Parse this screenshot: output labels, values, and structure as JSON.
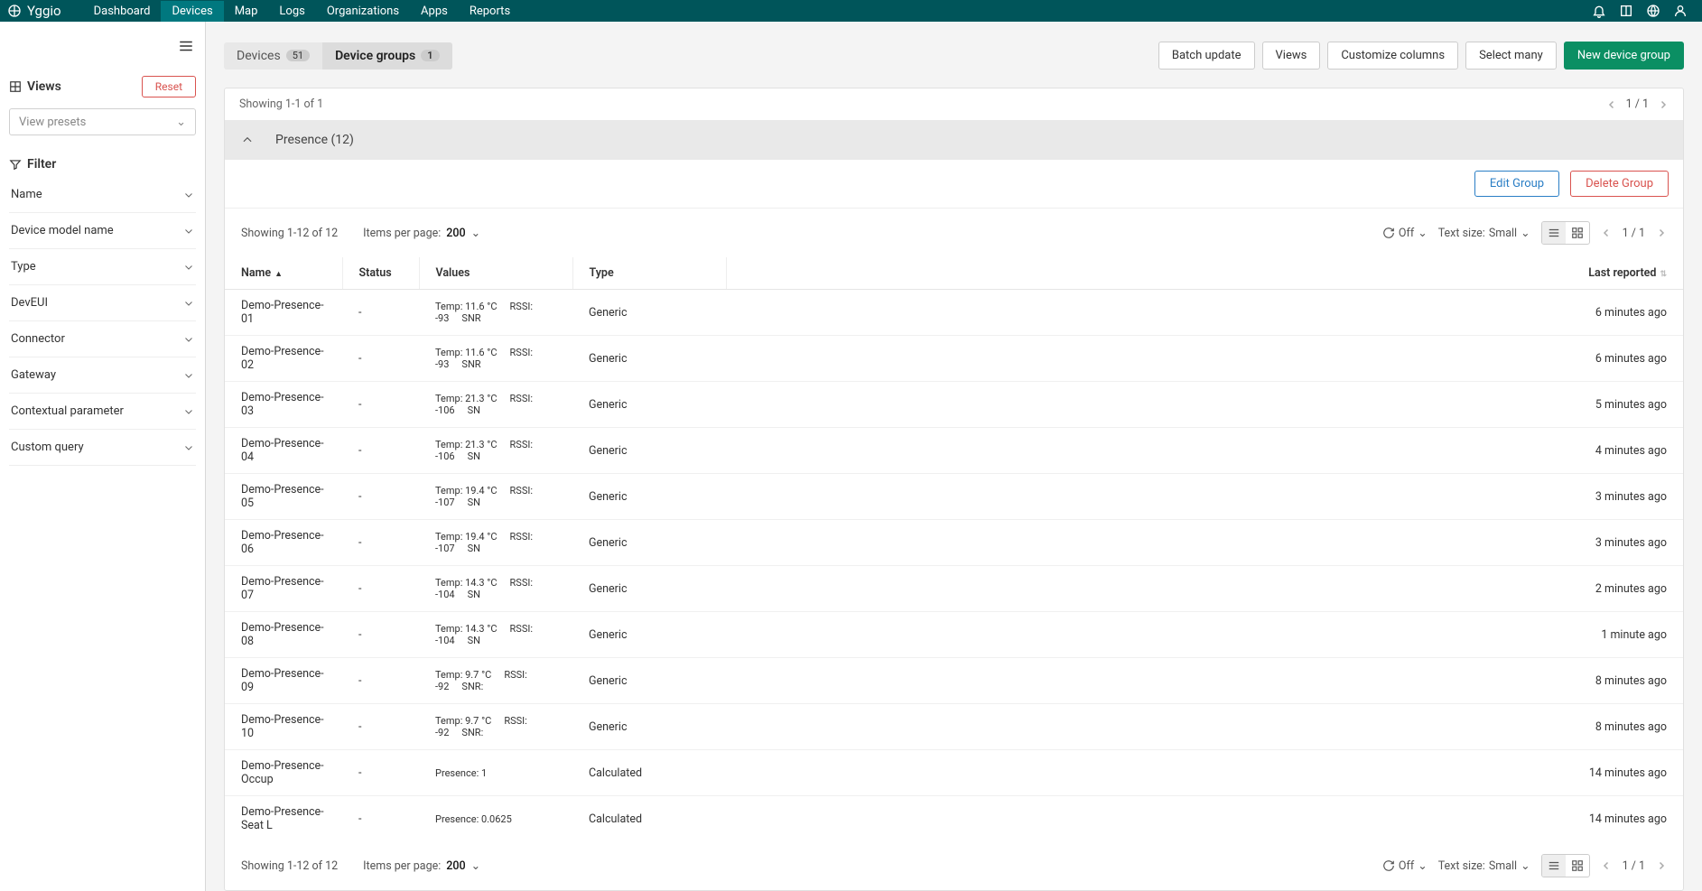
{
  "brand": "Yggio",
  "nav": [
    "Dashboard",
    "Devices",
    "Map",
    "Logs",
    "Organizations",
    "Apps",
    "Reports"
  ],
  "sidebar": {
    "views_label": "Views",
    "reset_label": "Reset",
    "preset_placeholder": "View presets",
    "filter_label": "Filter",
    "filters": [
      "Name",
      "Device model name",
      "Type",
      "DevEUI",
      "Connector",
      "Gateway",
      "Contextual parameter",
      "Custom query"
    ]
  },
  "tabs": {
    "devices_label": "Devices",
    "devices_count": "51",
    "groups_label": "Device groups",
    "groups_count": "1"
  },
  "actions": {
    "batch": "Batch update",
    "views": "Views",
    "customize": "Customize columns",
    "select_many": "Select many",
    "new_group": "New device group"
  },
  "group_pager": {
    "showing": "Showing 1-1 of 1",
    "page": "1 / 1"
  },
  "group": {
    "title": "Presence (12)",
    "edit": "Edit Group",
    "delete": "Delete Group"
  },
  "tbl": {
    "showing": "Showing 1-12 of 12",
    "ipp_label": "Items per page:",
    "ipp_value": "200",
    "off": "Off",
    "textsize_label": "Text size:",
    "textsize_value": "Small",
    "page": "1 / 1"
  },
  "columns": {
    "name": "Name",
    "status": "Status",
    "values": "Values",
    "type": "Type",
    "last": "Last reported"
  },
  "rows": [
    {
      "name": "Demo-Presence-01",
      "status": "-",
      "v": "Temp: 11.6 °C",
      "r": "RSSI: -93",
      "s": "SNR",
      "type": "Generic",
      "last": "6 minutes ago"
    },
    {
      "name": "Demo-Presence-02",
      "status": "-",
      "v": "Temp: 11.6 °C",
      "r": "RSSI: -93",
      "s": "SNR",
      "type": "Generic",
      "last": "6 minutes ago"
    },
    {
      "name": "Demo-Presence-03",
      "status": "-",
      "v": "Temp: 21.3 °C",
      "r": "RSSI: -106",
      "s": "SN",
      "type": "Generic",
      "last": "5 minutes ago"
    },
    {
      "name": "Demo-Presence-04",
      "status": "-",
      "v": "Temp: 21.3 °C",
      "r": "RSSI: -106",
      "s": "SN",
      "type": "Generic",
      "last": "4 minutes ago"
    },
    {
      "name": "Demo-Presence-05",
      "status": "-",
      "v": "Temp: 19.4 °C",
      "r": "RSSI: -107",
      "s": "SN",
      "type": "Generic",
      "last": "3 minutes ago"
    },
    {
      "name": "Demo-Presence-06",
      "status": "-",
      "v": "Temp: 19.4 °C",
      "r": "RSSI: -107",
      "s": "SN",
      "type": "Generic",
      "last": "3 minutes ago"
    },
    {
      "name": "Demo-Presence-07",
      "status": "-",
      "v": "Temp: 14.3 °C",
      "r": "RSSI: -104",
      "s": "SN",
      "type": "Generic",
      "last": "2 minutes ago"
    },
    {
      "name": "Demo-Presence-08",
      "status": "-",
      "v": "Temp: 14.3 °C",
      "r": "RSSI: -104",
      "s": "SN",
      "type": "Generic",
      "last": "1 minute ago"
    },
    {
      "name": "Demo-Presence-09",
      "status": "-",
      "v": "Temp: 9.7 °C",
      "r": "RSSI: -92",
      "s": "SNR:",
      "type": "Generic",
      "last": "8 minutes ago"
    },
    {
      "name": "Demo-Presence-10",
      "status": "-",
      "v": "Temp: 9.7 °C",
      "r": "RSSI: -92",
      "s": "SNR:",
      "type": "Generic",
      "last": "8 minutes ago"
    },
    {
      "name": "Demo-Presence-Occup",
      "status": "-",
      "v": "Presence: 1",
      "r": "",
      "s": "",
      "type": "Calculated",
      "last": "14 minutes ago"
    },
    {
      "name": "Demo-Presence-Seat L",
      "status": "-",
      "v": "Presence: 0.0625",
      "r": "",
      "s": "",
      "type": "Calculated",
      "last": "14 minutes ago"
    }
  ]
}
